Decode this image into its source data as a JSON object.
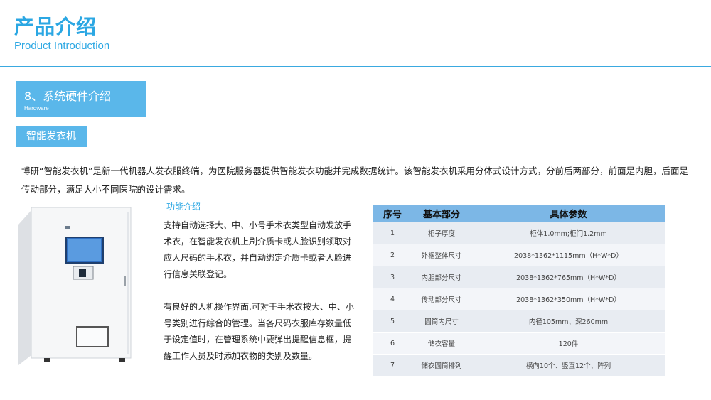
{
  "header": {
    "title_cn": "产品介绍",
    "title_en": "Product Introduction"
  },
  "section": {
    "title": "8、系统硬件介绍",
    "subtitle": "Hardware"
  },
  "product": {
    "name": "智能发衣机",
    "intro": "博研“智能发衣机”是新一代机器人发衣服终端，为医院服务器提供智能发衣功能并完成数据统计。该智能发衣机采用分体式设计方式，分前后两部分，前面是内胆，后面是传动部分，满足大小不同医院的设计需求。"
  },
  "features": {
    "title": "功能介绍",
    "paragraph1": "支持自动选择大、中、小号手术衣类型自动发放手术衣，在智能发衣机上刷介质卡或人脸识别领取对应人尺码的手术衣，并自动绑定介质卡或者人脸进行信息关联登记。",
    "paragraph2": "有良好的人机操作界面,可对于手术衣按大、中、小号类别进行综合的管理。当各尺码衣服库存数量低于设定值时，在管理系统中要弹出提醒信息框，提醒工作人员及时添加衣物的类别及数量。"
  },
  "spec_table": {
    "headers": [
      "序号",
      "基本部分",
      "具体参数"
    ],
    "rows": [
      [
        "1",
        "柜子厚度",
        "柜体1.0mm;柜门1.2mm"
      ],
      [
        "2",
        "外框整体尺寸",
        "2038*1362*1115mm（H*W*D）"
      ],
      [
        "3",
        "内胆部分尺寸",
        "2038*1362*765mm（H*W*D）"
      ],
      [
        "4",
        "传动部分尺寸",
        "2038*1362*350mm（H*W*D）"
      ],
      [
        "5",
        "圆筒内尺寸",
        "内径105mm、深260mm"
      ],
      [
        "6",
        "储衣容量",
        "120件"
      ],
      [
        "7",
        "储衣圆筒排列",
        "横向10个、竖直12个、阵列"
      ]
    ]
  },
  "colors": {
    "accent": "#2ba7e3",
    "box": "#5ab7ea",
    "table_header": "#7cb7e6"
  }
}
